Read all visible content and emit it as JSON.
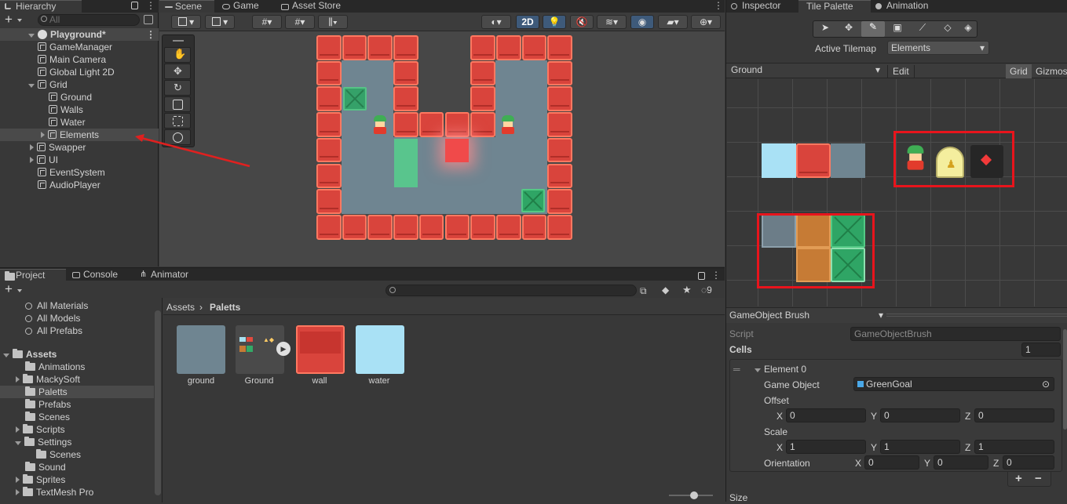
{
  "hierarchy": {
    "tab": "Hierarchy",
    "search_placeholder": "All",
    "add": "+",
    "scene": "Playground*",
    "items": [
      {
        "label": "GameManager",
        "indent": 1,
        "arrow": ""
      },
      {
        "label": "Main Camera",
        "indent": 1,
        "arrow": ""
      },
      {
        "label": "Global Light 2D",
        "indent": 1,
        "arrow": ""
      },
      {
        "label": "Grid",
        "indent": 1,
        "arrow": "down"
      },
      {
        "label": "Ground",
        "indent": 2,
        "arrow": ""
      },
      {
        "label": "Walls",
        "indent": 2,
        "arrow": ""
      },
      {
        "label": "Water",
        "indent": 2,
        "arrow": ""
      },
      {
        "label": "Elements",
        "indent": 2,
        "arrow": "right"
      },
      {
        "label": "Swapper",
        "indent": 1,
        "arrow": "right"
      },
      {
        "label": "UI",
        "indent": 1,
        "arrow": "right"
      },
      {
        "label": "EventSystem",
        "indent": 1,
        "arrow": ""
      },
      {
        "label": "AudioPlayer",
        "indent": 1,
        "arrow": ""
      }
    ]
  },
  "scene_tabs": {
    "scene": "Scene",
    "game": "Game",
    "store": "Asset Store",
    "mode_2d": "2D"
  },
  "project": {
    "tabs": [
      "Project",
      "Console",
      "Animator"
    ],
    "breadcrumb_root": "Assets",
    "breadcrumb_current": "Paletts",
    "hidden_count": "9",
    "favorites": [
      "All Materials",
      "All Models",
      "All Prefabs"
    ],
    "assets_root": "Assets",
    "folders": [
      {
        "label": "Animations",
        "indent": 1,
        "arrow": ""
      },
      {
        "label": "MackySoft",
        "indent": 1,
        "arrow": "right"
      },
      {
        "label": "Paletts",
        "indent": 1,
        "arrow": ""
      },
      {
        "label": "Prefabs",
        "indent": 1,
        "arrow": ""
      },
      {
        "label": "Scenes",
        "indent": 1,
        "arrow": ""
      },
      {
        "label": "Scripts",
        "indent": 1,
        "arrow": "right"
      },
      {
        "label": "Settings",
        "indent": 1,
        "arrow": "down"
      },
      {
        "label": "Scenes",
        "indent": 2,
        "arrow": ""
      },
      {
        "label": "Sound",
        "indent": 1,
        "arrow": ""
      },
      {
        "label": "Sprites",
        "indent": 1,
        "arrow": "right"
      },
      {
        "label": "TextMesh Pro",
        "indent": 1,
        "arrow": "right"
      }
    ],
    "assets": [
      {
        "label": "ground"
      },
      {
        "label": "Ground"
      },
      {
        "label": "wall"
      },
      {
        "label": "water"
      }
    ]
  },
  "right_tabs": {
    "inspector": "Inspector",
    "tile_palette": "Tile Palette",
    "animation": "Animation"
  },
  "palette": {
    "active_tilemap_label": "Active Tilemap",
    "active_tilemap": "Elements",
    "palette_name": "Ground",
    "edit": "Edit",
    "grid": "Grid",
    "gizmos": "Gizmos"
  },
  "brush": {
    "name": "GameObject Brush",
    "script_label": "Script",
    "script_value": "GameObjectBrush",
    "cells_label": "Cells",
    "cells_value": "1",
    "element": "Element 0",
    "game_object_label": "Game Object",
    "game_object_value": "GreenGoal",
    "offset_label": "Offset",
    "scale_label": "Scale",
    "orientation_label": "Orientation",
    "offset": {
      "x": "0",
      "y": "0",
      "z": "0"
    },
    "scale": {
      "x": "1",
      "y": "1",
      "z": "1"
    },
    "orientation": {
      "x": "0",
      "y": "0",
      "z": "0"
    },
    "x": "X",
    "y": "Y",
    "z": "Z",
    "plus": "+",
    "minus": "−",
    "size_label": "Size"
  }
}
